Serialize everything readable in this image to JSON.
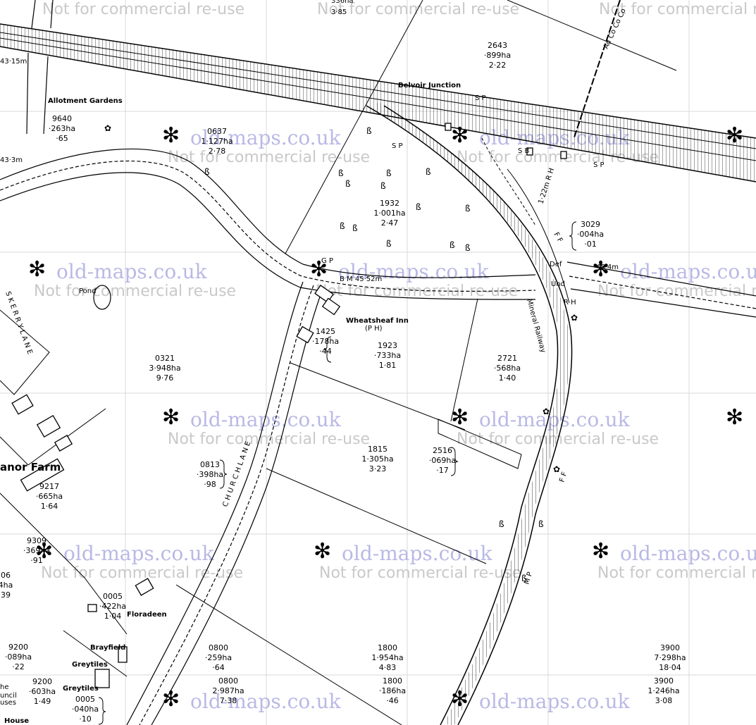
{
  "watermark": {
    "brand": "old-maps.co.uk",
    "tm": "™",
    "notice": "Not for commercial re-use",
    "top_partial_1": "Not for commercial re-use",
    "top_partial_2": "Not for commercial re-use",
    "top_partial_3": "Not for commercial re-use"
  },
  "map": {
    "place_labels": {
      "belvoir_junction": "Belvoir Junction",
      "allotment_gardens": "Allotment Gardens",
      "pond": "Pond",
      "wheatsheaf_inn": "Wheatsheaf Inn",
      "ph": "(P H)",
      "manor_farm": "anor Farm",
      "floradeen": "Floradeen",
      "brayfield": "Brayfield",
      "greytiles_1": "Greytiles",
      "greytiles_2": "Greytiles",
      "mineral_railway": "Mineral Railway",
      "church_lane": "C H U R C H   L A N E",
      "skerry_lane": "S K E R R Y   L A N E",
      "council_1": "he",
      "council_2": "uncil",
      "council_3": "uses",
      "house": "House"
    },
    "annotations": {
      "sp1": "S P",
      "sp2": "S P",
      "sp3": "S P",
      "sb": "S B",
      "gp": "G P",
      "bm": "B M  45·52m",
      "height_43_15": "43·15m",
      "height_43_3": "43·3m",
      "height_45_4": "45·4m",
      "height_1_22": "1·22m R H",
      "rh": "R H",
      "ff1": "F F",
      "ff2": "F F",
      "und": "Und",
      "def": "Def",
      "mp": "M P",
      "adcoco": "Ad Co Co Co",
      "top_area": "3·85",
      "top_parcel": "336ha"
    },
    "parcels": [
      {
        "id": "2643",
        "area": "·899ha",
        "acres": "2·22"
      },
      {
        "id": "9640",
        "area": "·263ha",
        "acres": "·65"
      },
      {
        "id": "0637",
        "area": "1·127ha",
        "acres": "2·78"
      },
      {
        "id": "1932",
        "area": "1·001ha",
        "acres": "2·47"
      },
      {
        "id": "3029",
        "area": "·004ha",
        "acres": "·01"
      },
      {
        "id": "1425",
        "area": "·178ha",
        "acres": "·44"
      },
      {
        "id": "1923",
        "area": "·733ha",
        "acres": "1·81"
      },
      {
        "id": "2721",
        "area": "·568ha",
        "acres": "1·40"
      },
      {
        "id": "0321",
        "area": "3·948ha",
        "acres": "9·76"
      },
      {
        "id": "1815",
        "area": "1·305ha",
        "acres": "3·23"
      },
      {
        "id": "2516",
        "area": "·069ha",
        "acres": "·17"
      },
      {
        "id": "0813",
        "area": "·398ha",
        "acres": "·98"
      },
      {
        "id": "9217",
        "area": "·665ha",
        "acres": "1·64"
      },
      {
        "id": "9309",
        "area": "·369ha",
        "acres": "·91"
      },
      {
        "id": "06",
        "area": "4ha",
        "acres": "39"
      },
      {
        "id": "0005",
        "area": "·422ha",
        "acres": "1·04"
      },
      {
        "id": "9200",
        "area": "·089ha",
        "acres": "·22"
      },
      {
        "id": "0800",
        "area": "·259ha",
        "acres": "·64"
      },
      {
        "id": "1800",
        "area": "1·954ha",
        "acres": "4·83"
      },
      {
        "id": "3900",
        "area": "7·298ha",
        "acres": "18·04"
      },
      {
        "id": "9200",
        "area": "·603ha",
        "acres": "1·49"
      },
      {
        "id": "0005",
        "area": "·040ha",
        "acres": "·10"
      },
      {
        "id": "0800",
        "area": "2·987ha",
        "acres": "7·38"
      },
      {
        "id": "1800",
        "area": "·186ha",
        "acres": "·46"
      },
      {
        "id": "3900",
        "area": "1·246ha",
        "acres": "3·08"
      }
    ]
  }
}
